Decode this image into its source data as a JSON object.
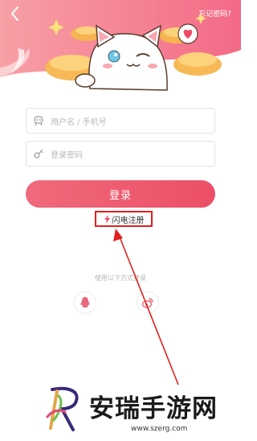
{
  "header": {
    "forgot_password": "忘记密码?"
  },
  "form": {
    "username_placeholder": "用户名 / 手机号",
    "password_placeholder": "登录密码",
    "login_label": "登录",
    "quick_register_label": "闪电注册"
  },
  "social": {
    "caption": "使用以下方式登录",
    "icons": [
      "qq-icon",
      "weibo-icon"
    ]
  },
  "watermark": {
    "title": "安瑞手游网",
    "url": "www.szerg.com"
  },
  "colors": {
    "accent": "#ec4f67",
    "header_pink": "#f47a8c",
    "highlight_red": "#e21f1f"
  }
}
